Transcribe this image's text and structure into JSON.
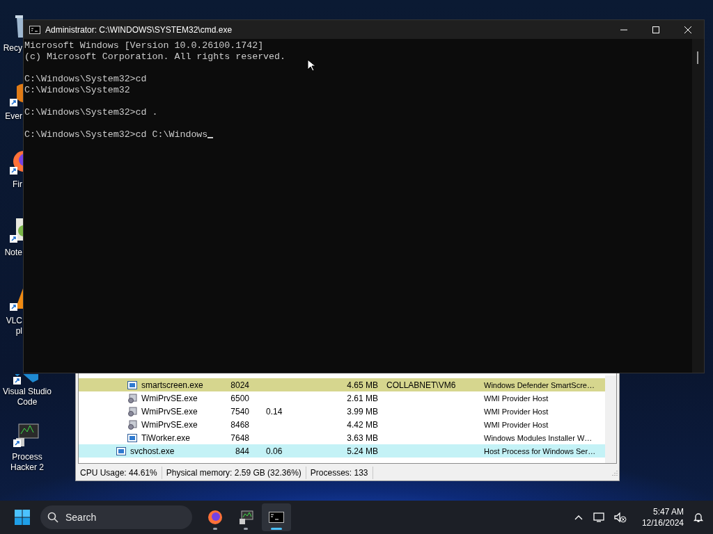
{
  "desktop_icons": [
    {
      "kind": "recycle-bin",
      "label_lines": [
        "Recy"
      ],
      "covered_right": true,
      "covered_top": false,
      "shortcut": false
    },
    {
      "kind": "evernote",
      "label_lines": [
        "Ever"
      ],
      "covered_right": true,
      "covered_top": false,
      "shortcut": true
    },
    {
      "kind": "firefox",
      "label_lines": [
        "Fir"
      ],
      "covered_right": true,
      "covered_top": false,
      "shortcut": true
    },
    {
      "kind": "notepad",
      "label_lines": [
        "Note"
      ],
      "covered_right": true,
      "covered_top": false,
      "shortcut": true
    },
    {
      "kind": "vlc",
      "label_lines": [
        "VLC",
        "pl"
      ],
      "covered_right": true,
      "covered_top": false,
      "shortcut": true
    },
    {
      "kind": "vscode",
      "label_lines": [
        "Visual Studio",
        "Code"
      ],
      "covered_right": false,
      "covered_top": true,
      "shortcut": true
    },
    {
      "kind": "process-hacker",
      "label_lines": [
        "Process",
        "Hacker 2"
      ],
      "covered_right": false,
      "covered_top": false,
      "shortcut": true
    }
  ],
  "process_hacker": {
    "rows": [
      {
        "children": [
          {
            "kind": "window",
            "name": "smartscreen.exe",
            "pid": "8024",
            "private_bytes": "4.65 MB",
            "user_name": "COLLABNET\\VM6",
            "description": "Windows Defender SmartScre…",
            "color": "#d6d68e"
          },
          {
            "kind": "service",
            "name": "WmiPrvSE.exe",
            "pid": "6500",
            "private_bytes": "2.61 MB",
            "description": "WMI Provider Host",
            "color": "#ffffff"
          },
          {
            "kind": "service",
            "name": "WmiPrvSE.exe",
            "pid": "7540",
            "cpu": "0.14",
            "private_bytes": "3.99 MB",
            "description": "WMI Provider Host",
            "color": "#ffffff"
          },
          {
            "kind": "service",
            "name": "WmiPrvSE.exe",
            "pid": "8468",
            "private_bytes": "4.42 MB",
            "description": "WMI Provider Host",
            "color": "#ffffff"
          },
          {
            "kind": "window",
            "name": "TiWorker.exe",
            "pid": "7648",
            "private_bytes": "3.63 MB",
            "description": "Windows Modules Installer W…",
            "color": "#ffffff"
          }
        ]
      },
      {
        "kind": "window",
        "name": "svchost.exe",
        "pid": "844",
        "cpu": "0.06",
        "private_bytes": "5.24 MB",
        "description": "Host Process for Windows Ser…",
        "color": "#c4f2f6"
      }
    ],
    "status_bar": [
      "CPU Usage: 44.61%",
      "Physical memory: 2.59 GB (32.36%)",
      "Processes: 133"
    ]
  },
  "cmd_window": {
    "title": "Administrator: C:\\WINDOWS\\SYSTEM32\\cmd.exe",
    "blocks": [
      [
        "Microsoft Windows [Version 10.0.26100.1742]",
        "(c) Microsoft Corporation. All rights reserved."
      ],
      [
        "C:\\Windows\\System32>cd",
        "C:\\Windows\\System32"
      ],
      [
        "C:\\Windows\\System32>cd ."
      ],
      [
        "C:\\Windows\\System32>cd C:\\Windows"
      ]
    ]
  },
  "taskbar": {
    "search": {
      "placeholder": "Search"
    },
    "apps": [
      {
        "kind": "firefox",
        "running": true,
        "selected": false
      },
      {
        "kind": "process-hacker",
        "running": true,
        "selected": false
      },
      {
        "kind": "terminal",
        "running": true,
        "selected": true
      }
    ],
    "clock": {
      "time": "5:47 AM",
      "date": "12/16/2024"
    }
  }
}
